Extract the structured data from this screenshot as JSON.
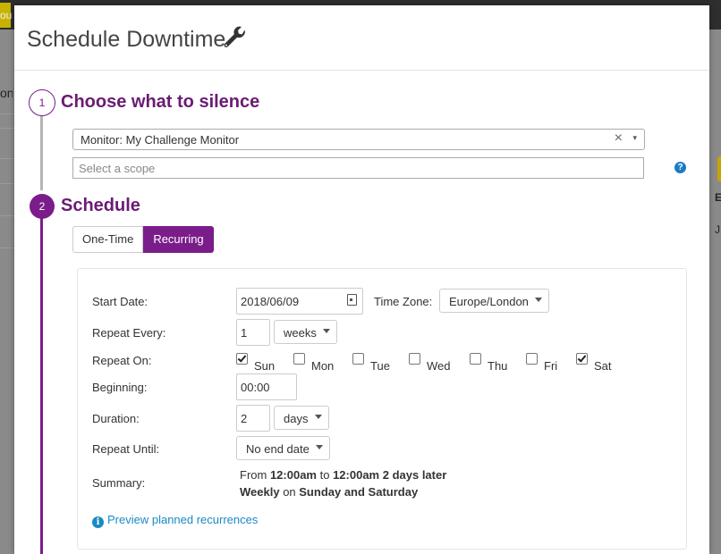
{
  "background": {
    "left_text": "on",
    "top_text": "ou",
    "right_bold_text": "E",
    "right_text": "J"
  },
  "modal": {
    "title": "Schedule Downtime",
    "title_icon": "wrench-icon"
  },
  "steps": [
    {
      "number": "1",
      "title": "Choose what to silence"
    },
    {
      "number": "2",
      "title": "Schedule"
    }
  ],
  "silence": {
    "monitor_value": "Monitor: My Challenge Monitor",
    "clear_glyph": "×",
    "caret_glyph": "▾",
    "scope_placeholder": "Select a scope",
    "help_glyph": "?"
  },
  "schedule": {
    "tabs": [
      {
        "label": "One-Time",
        "active": false
      },
      {
        "label": "Recurring",
        "active": true
      }
    ],
    "labels": {
      "start_date": "Start Date:",
      "time_zone": "Time Zone:",
      "repeat_every": "Repeat Every:",
      "repeat_on": "Repeat On:",
      "beginning": "Beginning:",
      "duration": "Duration:",
      "repeat_until": "Repeat Until:",
      "summary": "Summary:"
    },
    "start_date": "2018/06/09",
    "time_zone": "Europe/London",
    "repeat_every_value": "1",
    "repeat_every_unit": "weeks",
    "days": [
      {
        "label": "Sun",
        "checked": true
      },
      {
        "label": "Mon",
        "checked": false
      },
      {
        "label": "Tue",
        "checked": false
      },
      {
        "label": "Wed",
        "checked": false
      },
      {
        "label": "Thu",
        "checked": false
      },
      {
        "label": "Fri",
        "checked": false
      },
      {
        "label": "Sat",
        "checked": true
      }
    ],
    "beginning": "00:00",
    "duration_value": "2",
    "duration_unit": "days",
    "repeat_until": "No end date",
    "summary": {
      "line1_prefix": "From ",
      "line1_start": "12:00am",
      "line1_mid": " to ",
      "line1_end": "12:00am 2 days later",
      "line2_freq": "Weekly",
      "line2_mid": " on ",
      "line2_days": "Sunday and Saturday"
    },
    "preview_link": "Preview planned recurrences",
    "preview_icon_glyph": "i"
  },
  "colors": {
    "accent": "#7a1d8a",
    "step_title": "#6b1b73",
    "link": "#1a8ac6",
    "step1_line": "#b5b5b5"
  }
}
